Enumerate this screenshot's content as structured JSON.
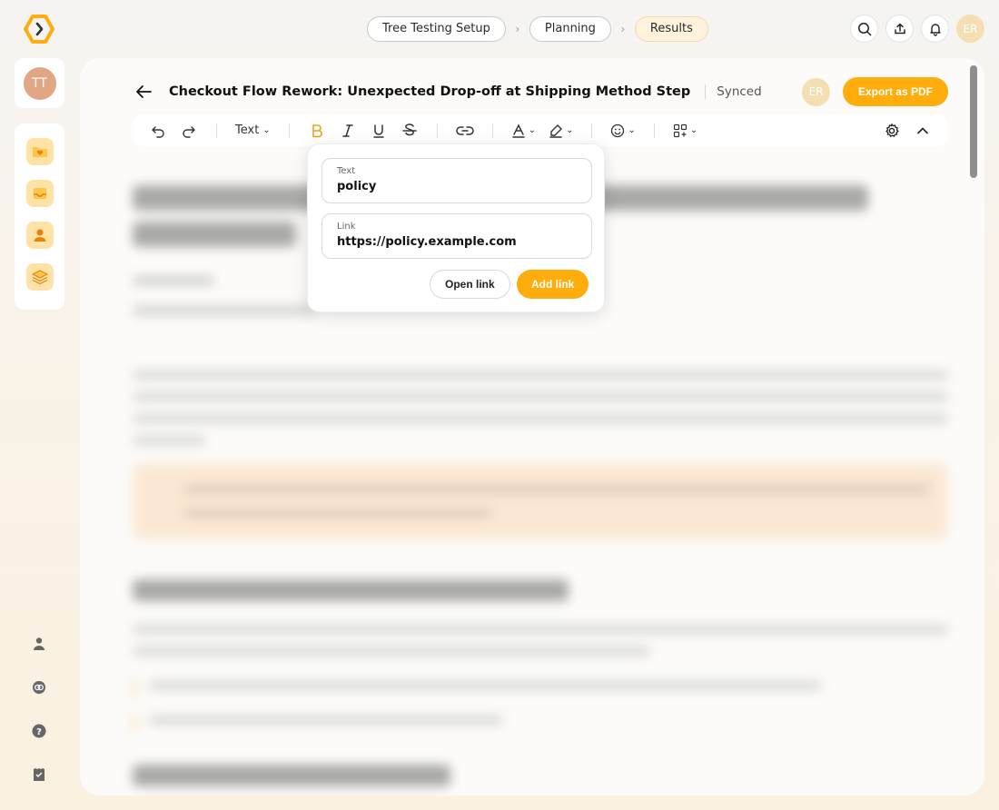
{
  "breadcrumbs": [
    {
      "label": "Tree Testing Setup"
    },
    {
      "label": "Planning"
    },
    {
      "label": "Results"
    }
  ],
  "user": {
    "initials": "ER"
  },
  "rail": {
    "profile_initials": "TT"
  },
  "document": {
    "title": "Checkout Flow Rework: Unexpected Drop-off at Shipping Method Step",
    "sync_status": "Synced",
    "export_label": "Export as PDF",
    "collaborator_initials": "ER"
  },
  "toolbar": {
    "text_style": "Text"
  },
  "link_popover": {
    "text_label": "Text",
    "text_value": "policy",
    "link_label": "Link",
    "link_value": "https://policy.example.com",
    "open_label": "Open link",
    "add_label": "Add link"
  },
  "colors": {
    "accent": "#ffad0d",
    "active_crumb_bg": "#fff3dd",
    "bold_icon": "#f0a020"
  }
}
